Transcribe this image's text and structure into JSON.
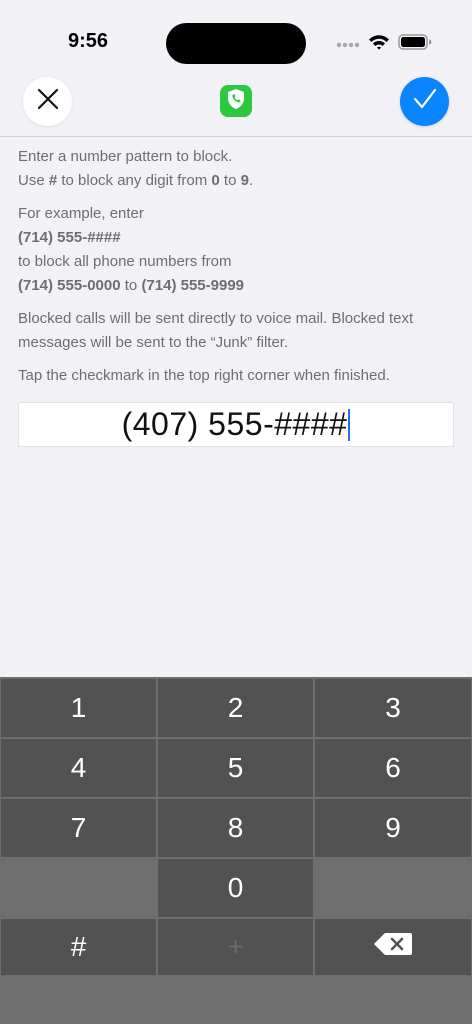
{
  "status_bar": {
    "time": "9:56"
  },
  "nav": {
    "close_icon": "close-icon",
    "app_icon": "phone-shield-icon",
    "done_icon": "checkmark-icon",
    "app_color": "#2bc840",
    "done_color": "#0a84ff"
  },
  "instructions": {
    "line1": "Enter a number pattern to block.",
    "line2_pre": "Use ",
    "line2_hash": "#",
    "line2_mid": " to block any digit from ",
    "line2_from": "0",
    "line2_to_word": " to ",
    "line2_to": "9",
    "line2_end": ".",
    "example_intro": "For example, enter",
    "example_pattern": "(714) 555-####",
    "example_block": "to block all phone numbers from",
    "example_range_start": "(714) 555-0000",
    "example_range_to": " to ",
    "example_range_end": "(714) 555-9999",
    "voicemail_note": "Blocked calls will be sent directly to voice mail.  Blocked text messages will be sent to the “Junk” filter.",
    "finish_note": "Tap the checkmark in the top right corner when finished."
  },
  "pattern_input": {
    "value": "(407) 555-####"
  },
  "keypad": {
    "k1": "1",
    "k2": "2",
    "k3": "3",
    "k4": "4",
    "k5": "5",
    "k6": "6",
    "k7": "7",
    "k8": "8",
    "k9": "9",
    "k0": "0",
    "hash": "#",
    "plus": "+",
    "delete_icon": "delete-backspace-icon"
  }
}
